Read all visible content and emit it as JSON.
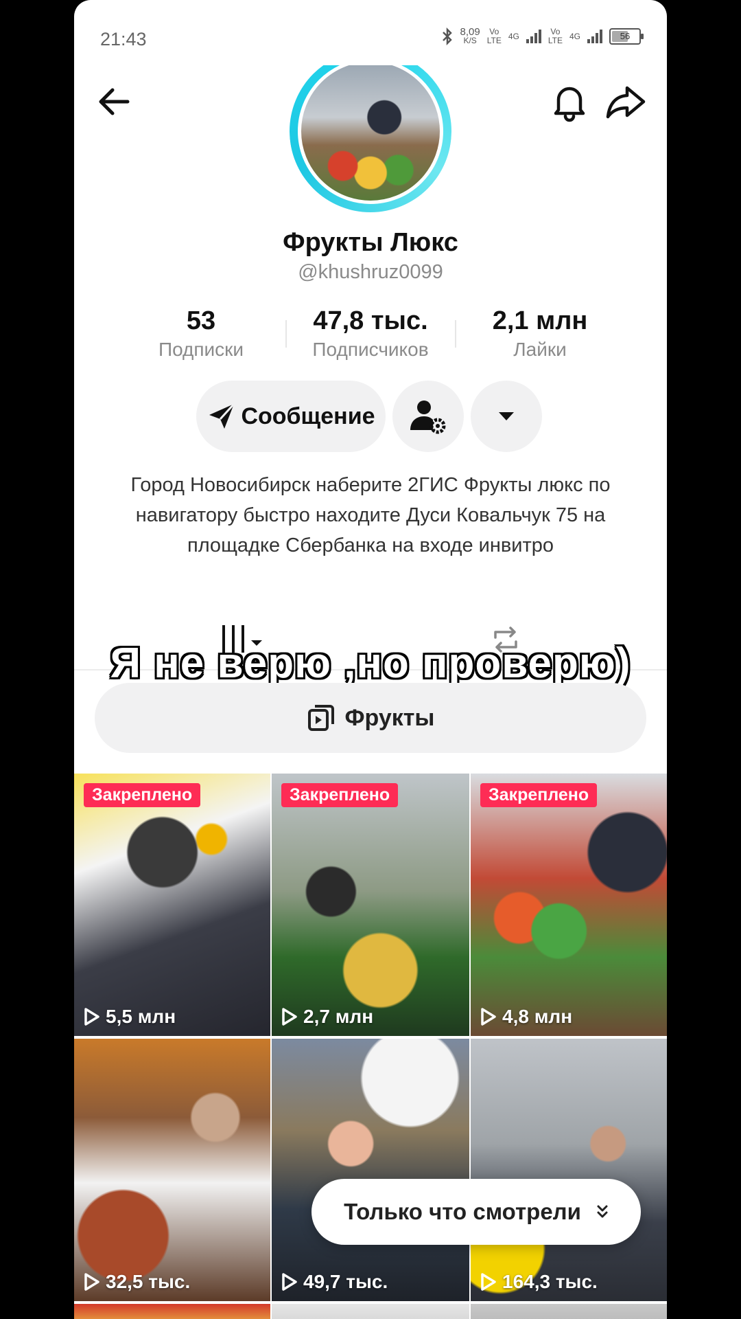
{
  "status_bar": {
    "time": "21:43",
    "net_speed": "8,09",
    "net_unit": "K/S",
    "sim1_top": "Vo",
    "sim1_bottom": "LTE",
    "sim1_gen": "4G",
    "sim2_top": "Vo",
    "sim2_bottom": "LTE",
    "sim2_gen": "4G",
    "battery": "56"
  },
  "profile": {
    "display_name": "Фрукты Люкс",
    "username": "@khushruz0099"
  },
  "stats": [
    {
      "value": "53",
      "label": "Подписки"
    },
    {
      "value": "47,8 тыс.",
      "label": "Подписчиков"
    },
    {
      "value": "2,1 млн",
      "label": "Лайки"
    }
  ],
  "actions": {
    "message_label": "Сообщение"
  },
  "bio": "Город Новосибирск наберите 2ГИС Фрукты люкс  по навигатору быстро находите Дуси Ковальчук 75 на площадке Сбербанка на входе инвитро",
  "overlay_caption": "Я не верю ,но проверю)",
  "playlist": {
    "label": "Фрукты"
  },
  "videos": [
    {
      "pinned": "Закреплено",
      "views": "5,5 млн"
    },
    {
      "pinned": "Закреплено",
      "views": "2,7 млн"
    },
    {
      "pinned": "Закреплено",
      "views": "4,8 млн"
    },
    {
      "pinned": "",
      "views": "32,5 тыс."
    },
    {
      "pinned": "",
      "views": "49,7 тыс."
    },
    {
      "pinned": "",
      "views": "164,3 тыс."
    }
  ],
  "recently_watched": {
    "label": "Только что смотрели"
  },
  "colors": {
    "accent_pink": "#fe2c55",
    "avatar_ring": "#20d5ec"
  }
}
